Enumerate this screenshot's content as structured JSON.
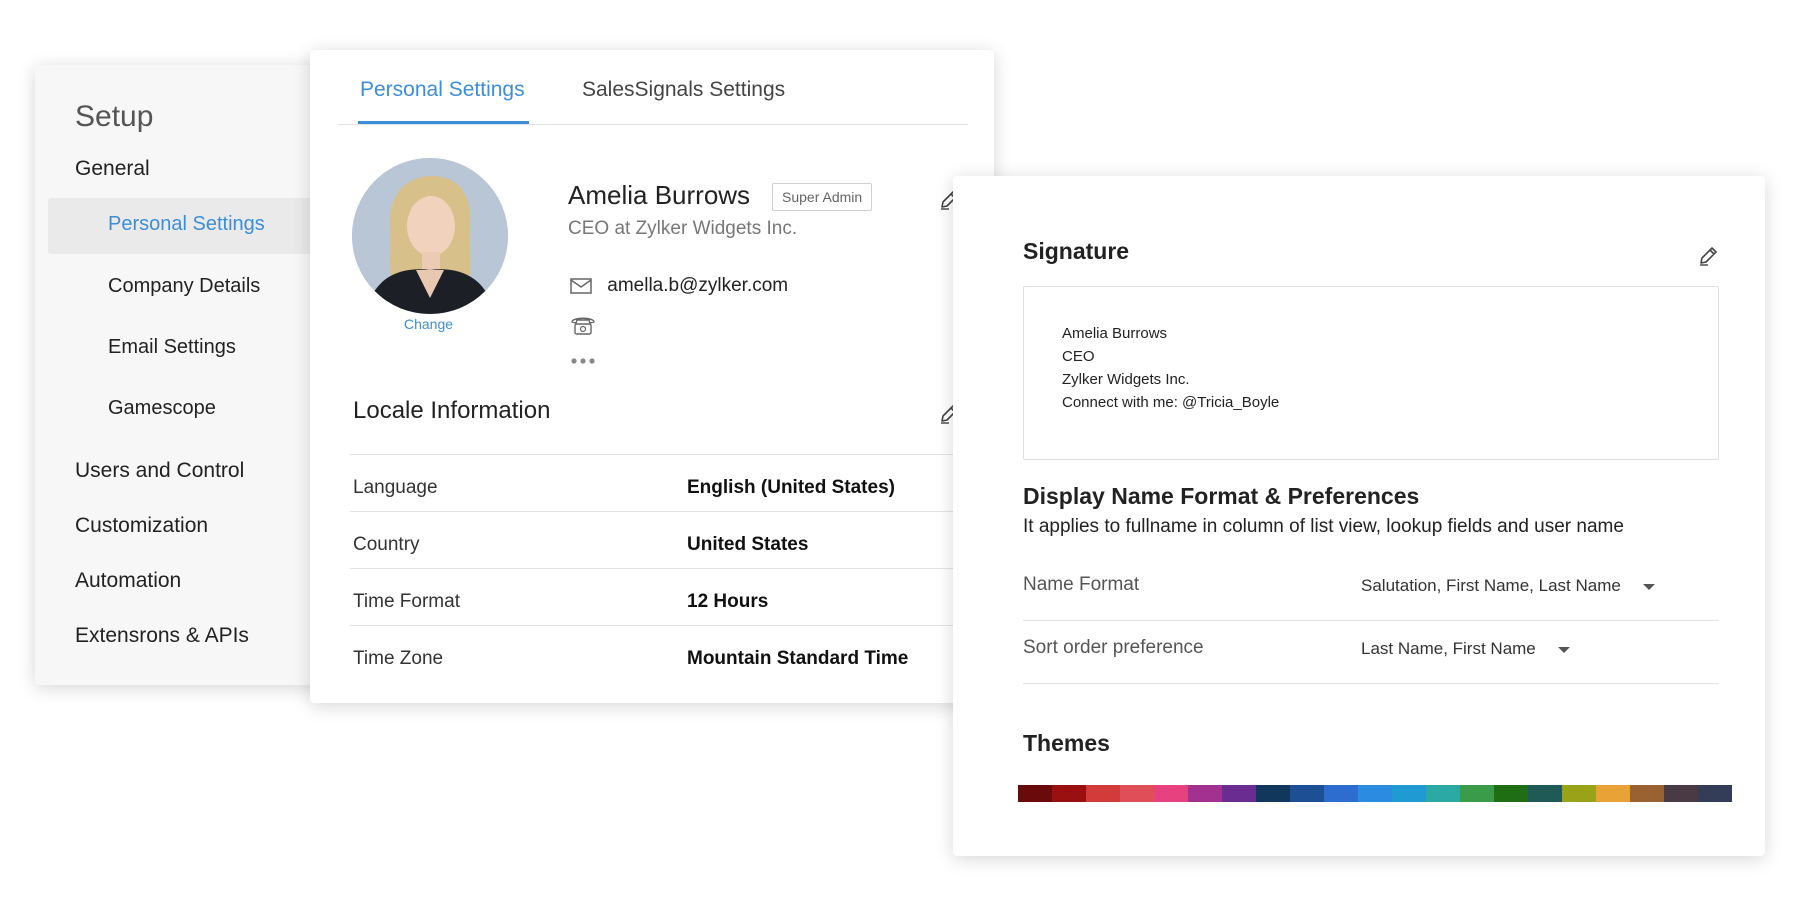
{
  "setup": {
    "title": "Setup",
    "general": "General",
    "sub_items": [
      "Personal Settings",
      "Company Details",
      "Email Settings",
      "Gamescope"
    ],
    "items": [
      "Users and Control",
      "Customization",
      "Automation",
      "Extensrons & APIs"
    ]
  },
  "personal": {
    "tabs": [
      "Personal Settings",
      "SalesSignals Settings"
    ],
    "change_link": "Change",
    "name": "Amelia Burrows",
    "role_badge": "Super Admin",
    "title": "CEO at Zylker Widgets Inc.",
    "email": "amella.b@zylker.com",
    "locale_title": "Locale Information",
    "locale": [
      {
        "label": "Language",
        "value": "English (United States)"
      },
      {
        "label": "Country",
        "value": "United States"
      },
      {
        "label": "Time Format",
        "value": "12 Hours"
      },
      {
        "label": "Time Zone",
        "value": "Mountain Standard Time"
      }
    ]
  },
  "prefs": {
    "signature_title": "Signature",
    "signature_lines": [
      "Amelia Burrows",
      "CEO",
      "Zylker Widgets Inc.",
      "Connect with me: @Tricia_Boyle"
    ],
    "display_title": "Display Name Format & Preferences",
    "display_subtitle": "It applies to fullname in column of list view, lookup fields and user name",
    "name_format_label": "Name Format",
    "name_format_value": "Salutation, First Name, Last Name",
    "sort_label": "Sort order preference",
    "sort_value": "Last Name, First Name",
    "themes_title": "Themes",
    "theme_colors": [
      "#6b0a0a",
      "#9a1010",
      "#d33a3a",
      "#e04e58",
      "#e8417f",
      "#a2318f",
      "#6a2c91",
      "#12375c",
      "#1c4f93",
      "#2c6dcf",
      "#2b8be0",
      "#1f9ad2",
      "#2ba9a5",
      "#3a9b49",
      "#1f6e14",
      "#1f5a56",
      "#9aa317",
      "#e9a235",
      "#9a6230",
      "#4a3a44",
      "#333d58"
    ]
  },
  "colors": {
    "accent": "#3d8ed8"
  }
}
